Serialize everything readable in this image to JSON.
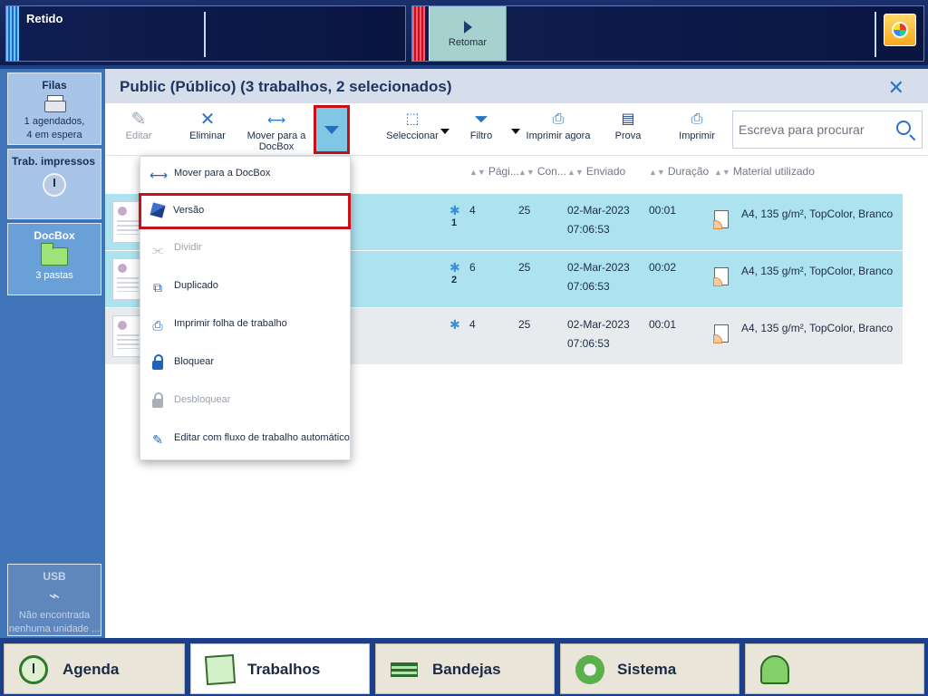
{
  "topbar": {
    "status_text": "Retido",
    "resume_label": "Retomar",
    "corner_icon": "color-dial-icon"
  },
  "sidebar": {
    "filas": {
      "title": "Filas",
      "line1": "1 agendados,",
      "line2": "4 em espera"
    },
    "trab": {
      "title": "Trab. impressos"
    },
    "docbox": {
      "title": "DocBox",
      "sub": "3 pastas"
    },
    "usb": {
      "title": "USB",
      "line1": "Não encontrada",
      "line2": "nenhuma unidade ..."
    }
  },
  "main": {
    "title": "Public (Público) (3 trabalhos, 2 selecionados)"
  },
  "toolbar": {
    "edit": "Editar",
    "delete": "Eliminar",
    "move_line1": "Mover para a",
    "move_line2": "DocBox",
    "select": "Seleccionar",
    "filter": "Filtro",
    "print_now": "Imprimir agora",
    "proof": "Prova",
    "print": "Imprimir",
    "search_placeholder": "Escreva para procurar"
  },
  "columns": {
    "pages": "Pági...",
    "copies": "Con...",
    "sent": "Enviado",
    "duration": "Duração",
    "media": "Material utilizado"
  },
  "rows": [
    {
      "pages": "4",
      "badge": "1",
      "copies": "25",
      "date": "02-Mar-2023",
      "time": "07:06:53",
      "duration": "00:01",
      "media": "A4, 135 g/m², TopColor, Branco"
    },
    {
      "pages": "6",
      "badge": "2",
      "copies": "25",
      "date": "02-Mar-2023",
      "time": "07:06:53",
      "duration": "00:02",
      "media": "A4, 135 g/m², TopColor, Branco"
    },
    {
      "pages": "4",
      "badge": "",
      "copies": "25",
      "date": "02-Mar-2023",
      "time": "07:06:53",
      "duration": "00:01",
      "media": "A4, 135 g/m², TopColor, Branco"
    }
  ],
  "menu": {
    "items": [
      {
        "label": "Mover para a DocBox",
        "icon": "move-arrows-icon",
        "enabled": true
      },
      {
        "label": "Versão",
        "icon": "version-cube-icon",
        "enabled": true
      },
      {
        "label": "Dividir",
        "icon": "split-icon",
        "enabled": false
      },
      {
        "label": "Duplicado",
        "icon": "duplicate-icon",
        "enabled": true
      },
      {
        "label": "Imprimir folha de trabalho",
        "icon": "print-worksheet-icon",
        "enabled": true
      },
      {
        "label": "Bloquear",
        "icon": "lock-icon",
        "enabled": true
      },
      {
        "label": "Desbloquear",
        "icon": "unlock-icon",
        "enabled": false
      },
      {
        "label": "Editar com fluxo de trabalho automático",
        "icon": "auto-workflow-icon",
        "enabled": true
      }
    ]
  },
  "bottomnav": {
    "agenda": "Agenda",
    "jobs": "Trabalhos",
    "trays": "Bandejas",
    "system": "Sistema"
  },
  "colors": {
    "accent": "#2a73c9",
    "highlight_border": "#c81016",
    "selected_row": "#ace3ef"
  }
}
